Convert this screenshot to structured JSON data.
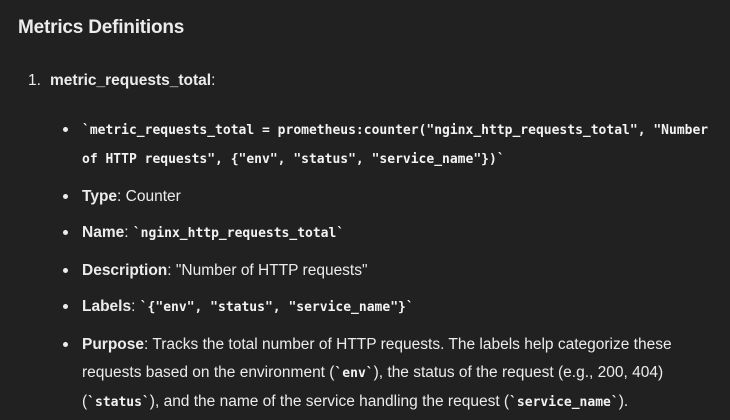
{
  "heading": "Metrics Definitions",
  "metric": {
    "number": "1.",
    "name": "metric_requests_total",
    "colon": ":",
    "code_def": "`metric_requests_total = prometheus:counter(\"nginx_http_requests_total\", \"Number of HTTP requests\", {\"env\", \"status\", \"service_name\"})`",
    "type_label": "Type",
    "type_value": ": Counter",
    "name_label": "Name",
    "name_sep": ": ",
    "name_value": "`nginx_http_requests_total`",
    "description_label": "Description",
    "description_value": ": \"Number of HTTP requests\"",
    "labels_label": "Labels",
    "labels_sep": ": ",
    "labels_value": "`{\"env\", \"status\", \"service_name\"}`",
    "purpose_label": "Purpose",
    "purpose_text_1": ": Tracks the total number of HTTP requests. The labels help categorize these requests based on the environment (",
    "purpose_code_env": "`env`",
    "purpose_text_2": "), the status of the request (e.g., 200, 404) (",
    "purpose_code_status": "`status`",
    "purpose_text_3": "), and the name of the service handling the request (",
    "purpose_code_service": "`service_name`",
    "purpose_text_4": ")."
  }
}
